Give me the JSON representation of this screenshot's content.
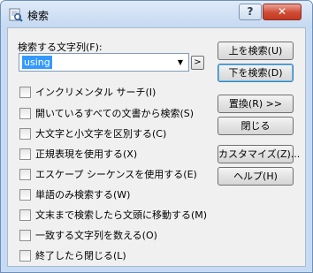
{
  "window": {
    "title": "検索",
    "help_label": "?",
    "close_label": "✕"
  },
  "find": {
    "label": "検索する文字列(F):",
    "value": "using",
    "extra_button_label": ">"
  },
  "buttons": {
    "find_up": "上を検索(U)",
    "find_down": "下を検索(D)",
    "replace": "置換(R) >>",
    "close": "閉じる",
    "customize": "カスタマイズ(Z)...",
    "help": "ヘルプ(H)"
  },
  "options": [
    {
      "label": "インクリメンタル サーチ(I)",
      "checked": false
    },
    {
      "label": "開いているすべての文書から検索(S)",
      "checked": false
    },
    {
      "label": "大文字と小文字を区別する(C)",
      "checked": false
    },
    {
      "label": "正規表現を使用する(X)",
      "checked": false
    },
    {
      "label": "エスケープ シーケンスを使用する(E)",
      "checked": false
    },
    {
      "label": "単語のみ検索する(W)",
      "checked": false
    },
    {
      "label": "文末まで検索したら文頭に移動する(M)",
      "checked": false
    },
    {
      "label": "一致する文字列を数える(O)",
      "checked": false
    },
    {
      "label": "終了したら閉じる(L)",
      "checked": false
    }
  ]
}
